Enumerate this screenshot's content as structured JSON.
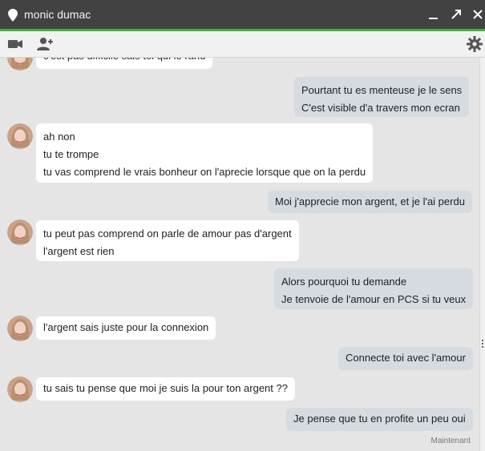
{
  "window": {
    "title": "monic dumac",
    "accent_color": "#3fb23f",
    "controls": [
      "minimize-icon",
      "popout-icon",
      "close-icon"
    ]
  },
  "toolbar": {
    "left_icons": [
      "video-call-icon",
      "add-person-icon"
    ],
    "right_icons": [
      "gear-icon"
    ]
  },
  "messages": [
    {
      "from": "them",
      "lines": [
        "c'est pas difficile sais toi qui le rand"
      ]
    },
    {
      "from": "me",
      "lines": [
        "Pourtant tu es menteuse je le sens",
        "C'est visible d'a travers mon ecran"
      ]
    },
    {
      "from": "them",
      "lines": [
        "ah non",
        "tu te trompe",
        "tu vas comprend le vrais bonheur on l'aprecie lorsque que on la perdu"
      ]
    },
    {
      "from": "me",
      "lines": [
        "Moi j'apprecie mon argent, et je l'ai perdu"
      ]
    },
    {
      "from": "them",
      "lines": [
        "tu peut pas comprend on parle de amour pas d'argent",
        "l'argent est rien"
      ]
    },
    {
      "from": "me",
      "lines": [
        "Alors pourquoi tu demande",
        "Je tenvoie de l'amour en PCS si tu veux"
      ]
    },
    {
      "from": "them",
      "lines": [
        "l'argent sais juste pour la connexion"
      ]
    },
    {
      "from": "me",
      "lines": [
        "Connecte toi avec l'amour"
      ]
    },
    {
      "from": "them",
      "lines": [
        "tu sais tu pense que moi je suis la pour ton argent ??"
      ]
    },
    {
      "from": "me",
      "lines": [
        "Je pense que tu en profite un peu oui"
      ]
    }
  ],
  "status": {
    "timestamp": "Maintenant"
  }
}
